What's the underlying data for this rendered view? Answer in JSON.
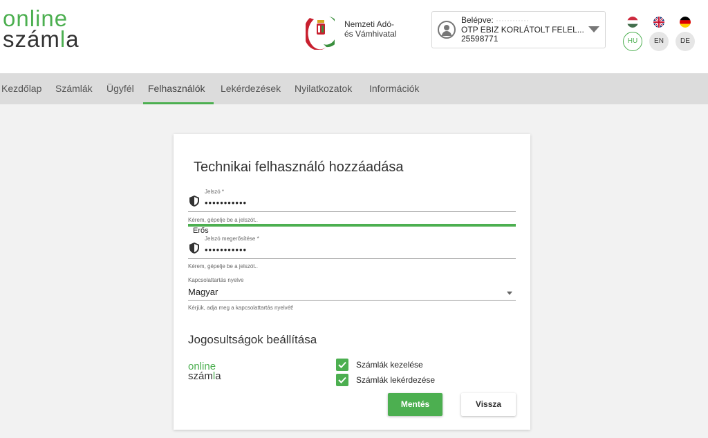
{
  "header": {
    "logo_line1": "online",
    "logo_line2a": "szám",
    "logo_line2b": "l",
    "logo_line2c": "a",
    "nav_authority_line1": "Nemzeti Adó-",
    "nav_authority_line2": "és Vámhivatal",
    "user": {
      "prefix": "Belépve:",
      "name_blurred": "············",
      "company": "OTP EBIZ KORLÁTOLT FELEL...",
      "tax_id": "25598771"
    },
    "languages": [
      {
        "code": "HU",
        "flag": "hungary-flag-icon",
        "active": true
      },
      {
        "code": "EN",
        "flag": "uk-flag-icon",
        "active": false
      },
      {
        "code": "DE",
        "flag": "germany-flag-icon",
        "active": false
      }
    ]
  },
  "nav": {
    "items": [
      "Kezdőlap",
      "Számlák",
      "Ügyfél",
      "Felhasználók",
      "Lekérdezések",
      "Nyilatkozatok",
      "Információk"
    ],
    "active": "Felhasználók"
  },
  "form": {
    "title": "Technikai felhasználó hozzáadása",
    "password": {
      "label": "Jelszó *",
      "value": "•••••••••••",
      "hint": "Kérem, gépelje be a jelszót.."
    },
    "strength": "Erős",
    "password_confirm": {
      "label": "Jelszó megerősítése *",
      "value": "•••••••••••",
      "hint": "Kérem, gépelje be a jelszót.."
    },
    "language": {
      "label": "Kapcsolattartás nyelve",
      "value": "Magyar",
      "hint": "Kérjük, adja meg a kapcsolattartás nyelvét!"
    },
    "permissions_title": "Jogosultságok beállítása",
    "permissions": [
      {
        "label": "Számlák kezelése",
        "checked": true
      },
      {
        "label": "Számlák lekérdezése",
        "checked": true
      }
    ],
    "save_label": "Mentés",
    "back_label": "Vissza"
  },
  "colors": {
    "accent": "#4caf50",
    "nav_bg": "#dcdcdc",
    "page_bg": "#f2f2f2"
  }
}
